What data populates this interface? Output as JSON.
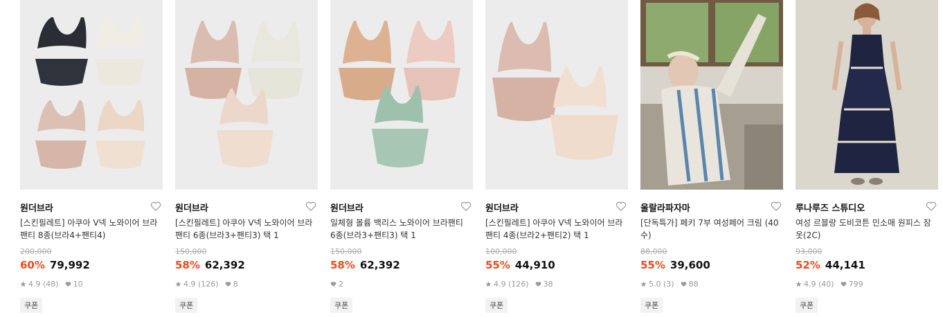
{
  "products": [
    {
      "brand": "원더브라",
      "title": "[스킨필레트] 아쿠아 V넥 노와이어 브라팬티 8종(브라4+팬티4)",
      "original_price": "200,000",
      "discount": "60%",
      "price": "79,992",
      "rating": "4.9",
      "reviews": "(48)",
      "likes": "10",
      "coupon": "쿠폰",
      "image": "bra-set-8-black-ivory-beige",
      "colors": [
        "#2a2d33",
        "#eeebe2",
        "#dcc2b4",
        "#ead7c8"
      ]
    },
    {
      "brand": "원더브라",
      "title": "[스킨필레트] 아쿠아 V넥 노와이어 브라팬티 6종(브라3+팬티3) 택 1",
      "original_price": "150,000",
      "discount": "58%",
      "price": "62,392",
      "rating": "4.9",
      "reviews": "(126)",
      "likes": "8",
      "coupon": "쿠폰",
      "image": "bra-set-6-pink-ivory-beige",
      "colors": [
        "#d9b9ad",
        "#e7e6dc",
        "#ecd5c6"
      ]
    },
    {
      "brand": "원더브라",
      "title": "일체형 볼륨 백리스 노와이어 브라팬티 6종(브라3+팬티3) 택 1",
      "original_price": "150,000",
      "discount": "58%",
      "price": "62,392",
      "rating": "",
      "reviews": "",
      "likes": "2",
      "coupon": "쿠폰",
      "image": "bra-set-6-tan-pink-mint",
      "colors": [
        "#dcb293",
        "#e8c6bd",
        "#9ec1ad"
      ]
    },
    {
      "brand": "원더브라",
      "title": "[스킨필레트] 아쿠아 V넥 노와이어 브라팬티 4종(브라2+팬티2) 택 1",
      "original_price": "100,000",
      "discount": "55%",
      "price": "44,910",
      "rating": "4.9",
      "reviews": "(126)",
      "likes": "38",
      "coupon": "쿠폰",
      "image": "bra-set-4-pink-beige",
      "colors": [
        "#d9b5a9",
        "#efd9c9"
      ]
    },
    {
      "brand": "울랄라파자마",
      "title": "[단독특가] 페키 7부 여성페어 크림 (40수)",
      "original_price": "88,000",
      "discount": "55%",
      "price": "39,600",
      "rating": "5.0",
      "reviews": "(3)",
      "likes": "88",
      "coupon": "쿠폰",
      "image": "woman-striped-pajamas-photo",
      "colors": [
        "#bfb8ab",
        "#6b8fae"
      ]
    },
    {
      "brand": "루나루즈 스튜디오",
      "title": "여성 르블랑 도비코튼 민소매 원피스 잠옷(2C)",
      "original_price": "93,000",
      "discount": "52%",
      "price": "44,141",
      "rating": "4.9",
      "reviews": "(40)",
      "likes": "799",
      "coupon": "쿠폰",
      "image": "woman-navy-dress-photo",
      "colors": [
        "#1f2540",
        "#d8d2c6"
      ]
    }
  ],
  "colors": {
    "discount": "#f1471d",
    "thumb_bg": "#ececec"
  }
}
